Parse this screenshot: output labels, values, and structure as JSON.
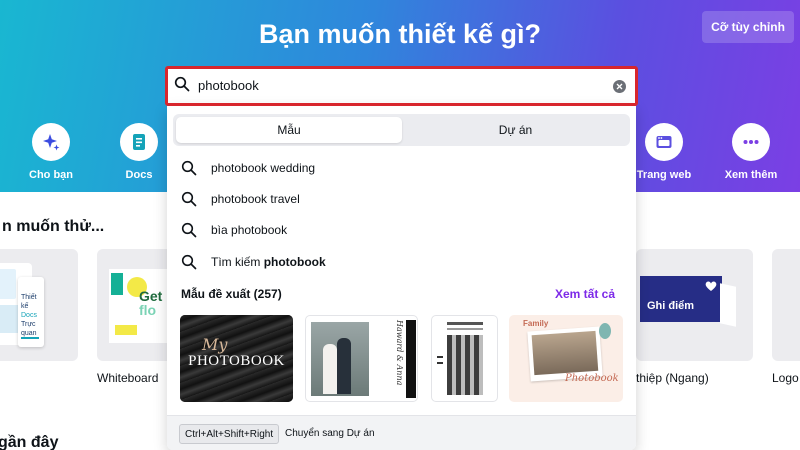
{
  "hero": {
    "title": "Bạn muốn thiết kế gì?",
    "custom_size_label": "Cỡ tùy chỉnh"
  },
  "categories": [
    {
      "label": "Cho bạn",
      "icon": "sparkles-icon"
    },
    {
      "label": "Docs",
      "icon": "doc-icon"
    },
    {
      "label": "Trang web",
      "icon": "website-icon"
    },
    {
      "label": "Xem thêm",
      "icon": "more-icon"
    }
  ],
  "sections": {
    "try_title": "n muốn thử...",
    "recent_title": "gần đây"
  },
  "cards": [
    {
      "label": "Whiteboard"
    },
    {
      "label": "thiệp (Ngang)",
      "thumb_text": "Ghi điểm"
    },
    {
      "label": "Logo"
    }
  ],
  "card_left_text": [
    "Thiết kế",
    "Docs",
    "Trực quan"
  ],
  "card_whiteboard_text": [
    "Get",
    "flo"
  ],
  "search": {
    "value": "photobook",
    "placeholder": ""
  },
  "dropdown": {
    "tabs": [
      "Mẫu",
      "Dự án"
    ],
    "active_tab": "Mẫu",
    "suggestions": [
      {
        "text": "photobook wedding"
      },
      {
        "text": "photobook travel"
      },
      {
        "text": "bìa photobook"
      }
    ],
    "search_all_prefix": "Tìm kiếm",
    "search_all_term": "photobook",
    "templates_heading": "Mẫu đề xuất (257)",
    "see_all": "Xem tất cả",
    "thumbs": [
      {
        "text": "PHOTOBOOK",
        "script": "My"
      },
      {
        "script": "Haward & Anna"
      },
      {},
      {
        "title": "Family",
        "subtitle": "Photobook"
      }
    ],
    "shortcut": "Ctrl+Alt+Shift+Right",
    "shortcut_hint": "Chuyển sang Dự án"
  },
  "colors": {
    "accent_purple": "#7d2ae8",
    "highlight_red": "#d8262d",
    "hero_start": "#19b7d1",
    "hero_end": "#7b3fe4"
  }
}
